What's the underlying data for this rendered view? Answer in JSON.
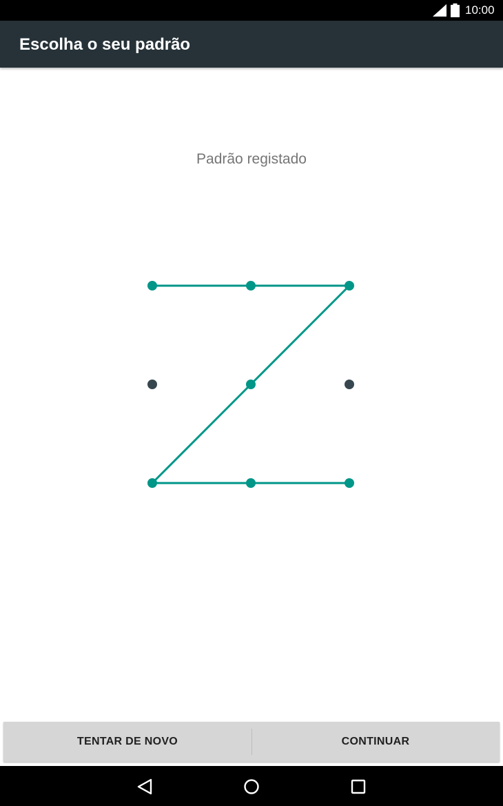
{
  "status_bar": {
    "time": "10:00",
    "icons": [
      "cell-signal-icon",
      "battery-icon"
    ]
  },
  "app_bar": {
    "title": "Escolha o seu padrão"
  },
  "pattern_screen": {
    "header_message": "Padrão registado",
    "grid": {
      "rows": 3,
      "cols": 3
    },
    "selected_sequence": [
      1,
      2,
      3,
      5,
      7,
      8,
      9
    ],
    "colors": {
      "selected": "#009688",
      "unselected": "#37474f",
      "line": "#009688"
    }
  },
  "buttons": {
    "retry_label": "TENTAR DE NOVO",
    "continue_label": "CONTINUAR"
  },
  "nav_bar": {
    "icons": [
      "back-icon",
      "home-icon",
      "recents-icon"
    ]
  }
}
